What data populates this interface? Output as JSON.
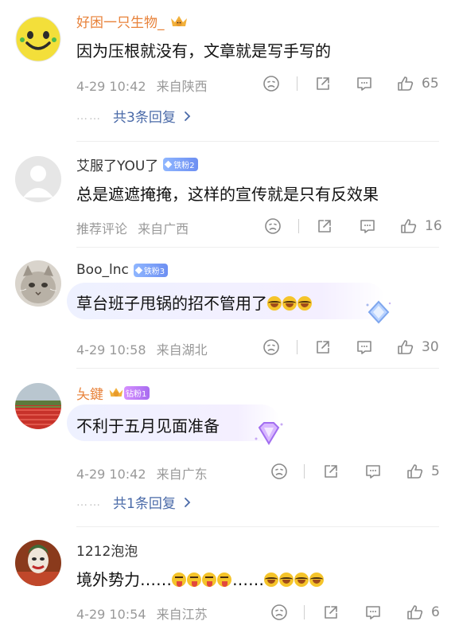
{
  "comments": [
    {
      "user": "好困一只生物_",
      "badge": "",
      "text": "因为压根就没有，文章就是写手写的",
      "time": "4-29 10:42",
      "location": "来自陕西",
      "likes": "65",
      "replies": "共3条回复"
    },
    {
      "user": "艾服了YOU了",
      "badge": "铁粉2",
      "text": "总是遮遮掩掩，这样的宣传就是只有反效果",
      "time": "推荐评论",
      "location": "来自广西",
      "likes": "16"
    },
    {
      "user": "Boo_lnc",
      "badge": "铁粉3",
      "text": "草台班子甩锅的招不管用了",
      "time": "4-29 10:58",
      "location": "来自湖北",
      "likes": "30"
    },
    {
      "user": "夨鍵",
      "badge": "钻粉1",
      "text": "不利于五月见面准备",
      "time": "4-29 10:42",
      "location": "来自广东",
      "likes": "5",
      "replies": "共1条回复"
    },
    {
      "user": "1212泡泡",
      "badge": "",
      "text_a": "境外势力……",
      "text_b": "……",
      "time": "4-29 10:54",
      "location": "来自江苏",
      "likes": "6"
    }
  ],
  "reply_dots": "……",
  "icons": [
    "dislike-icon",
    "share-icon",
    "comment-icon",
    "like-icon",
    "chevron-right-icon",
    "crown-icon",
    "laugh-emoji",
    "tongue-emoji"
  ],
  "colors": {
    "link": "#4a6aa8",
    "meta": "#999999",
    "orange_name": "#e8823a",
    "iron_badge": "#7aa0f6",
    "diamond_badge": "#b97cf5"
  }
}
